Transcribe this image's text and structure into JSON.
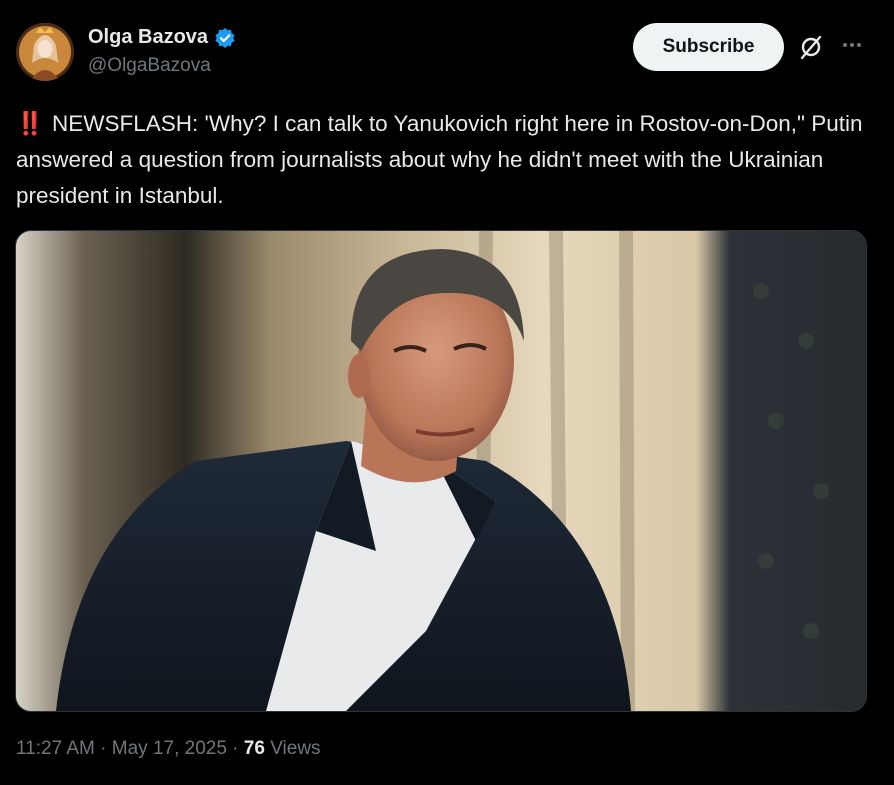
{
  "author": {
    "display_name": "Olga Bazova",
    "handle": "@OlgaBazova",
    "verified": true
  },
  "actions": {
    "subscribe_label": "Subscribe",
    "grok_icon": "grok-icon",
    "more_icon": "more-icon"
  },
  "tweet": {
    "emoji": "‼️",
    "text": "NEWSFLASH: 'Why? I can talk to Yanukovich right here in Rostov-on-Don,\" Putin answered a question from journalists about why he didn't meet with the Ukrainian president in Istanbul."
  },
  "meta": {
    "time": "11:27 AM",
    "separator": " · ",
    "date": "May 17, 2025",
    "views_count": "76",
    "views_label": "Views"
  },
  "colors": {
    "background": "#000000",
    "text": "#e7e9ea",
    "secondary": "#71767b",
    "verified": "#1d9bf0",
    "subscribe_bg": "#eff3f4"
  }
}
